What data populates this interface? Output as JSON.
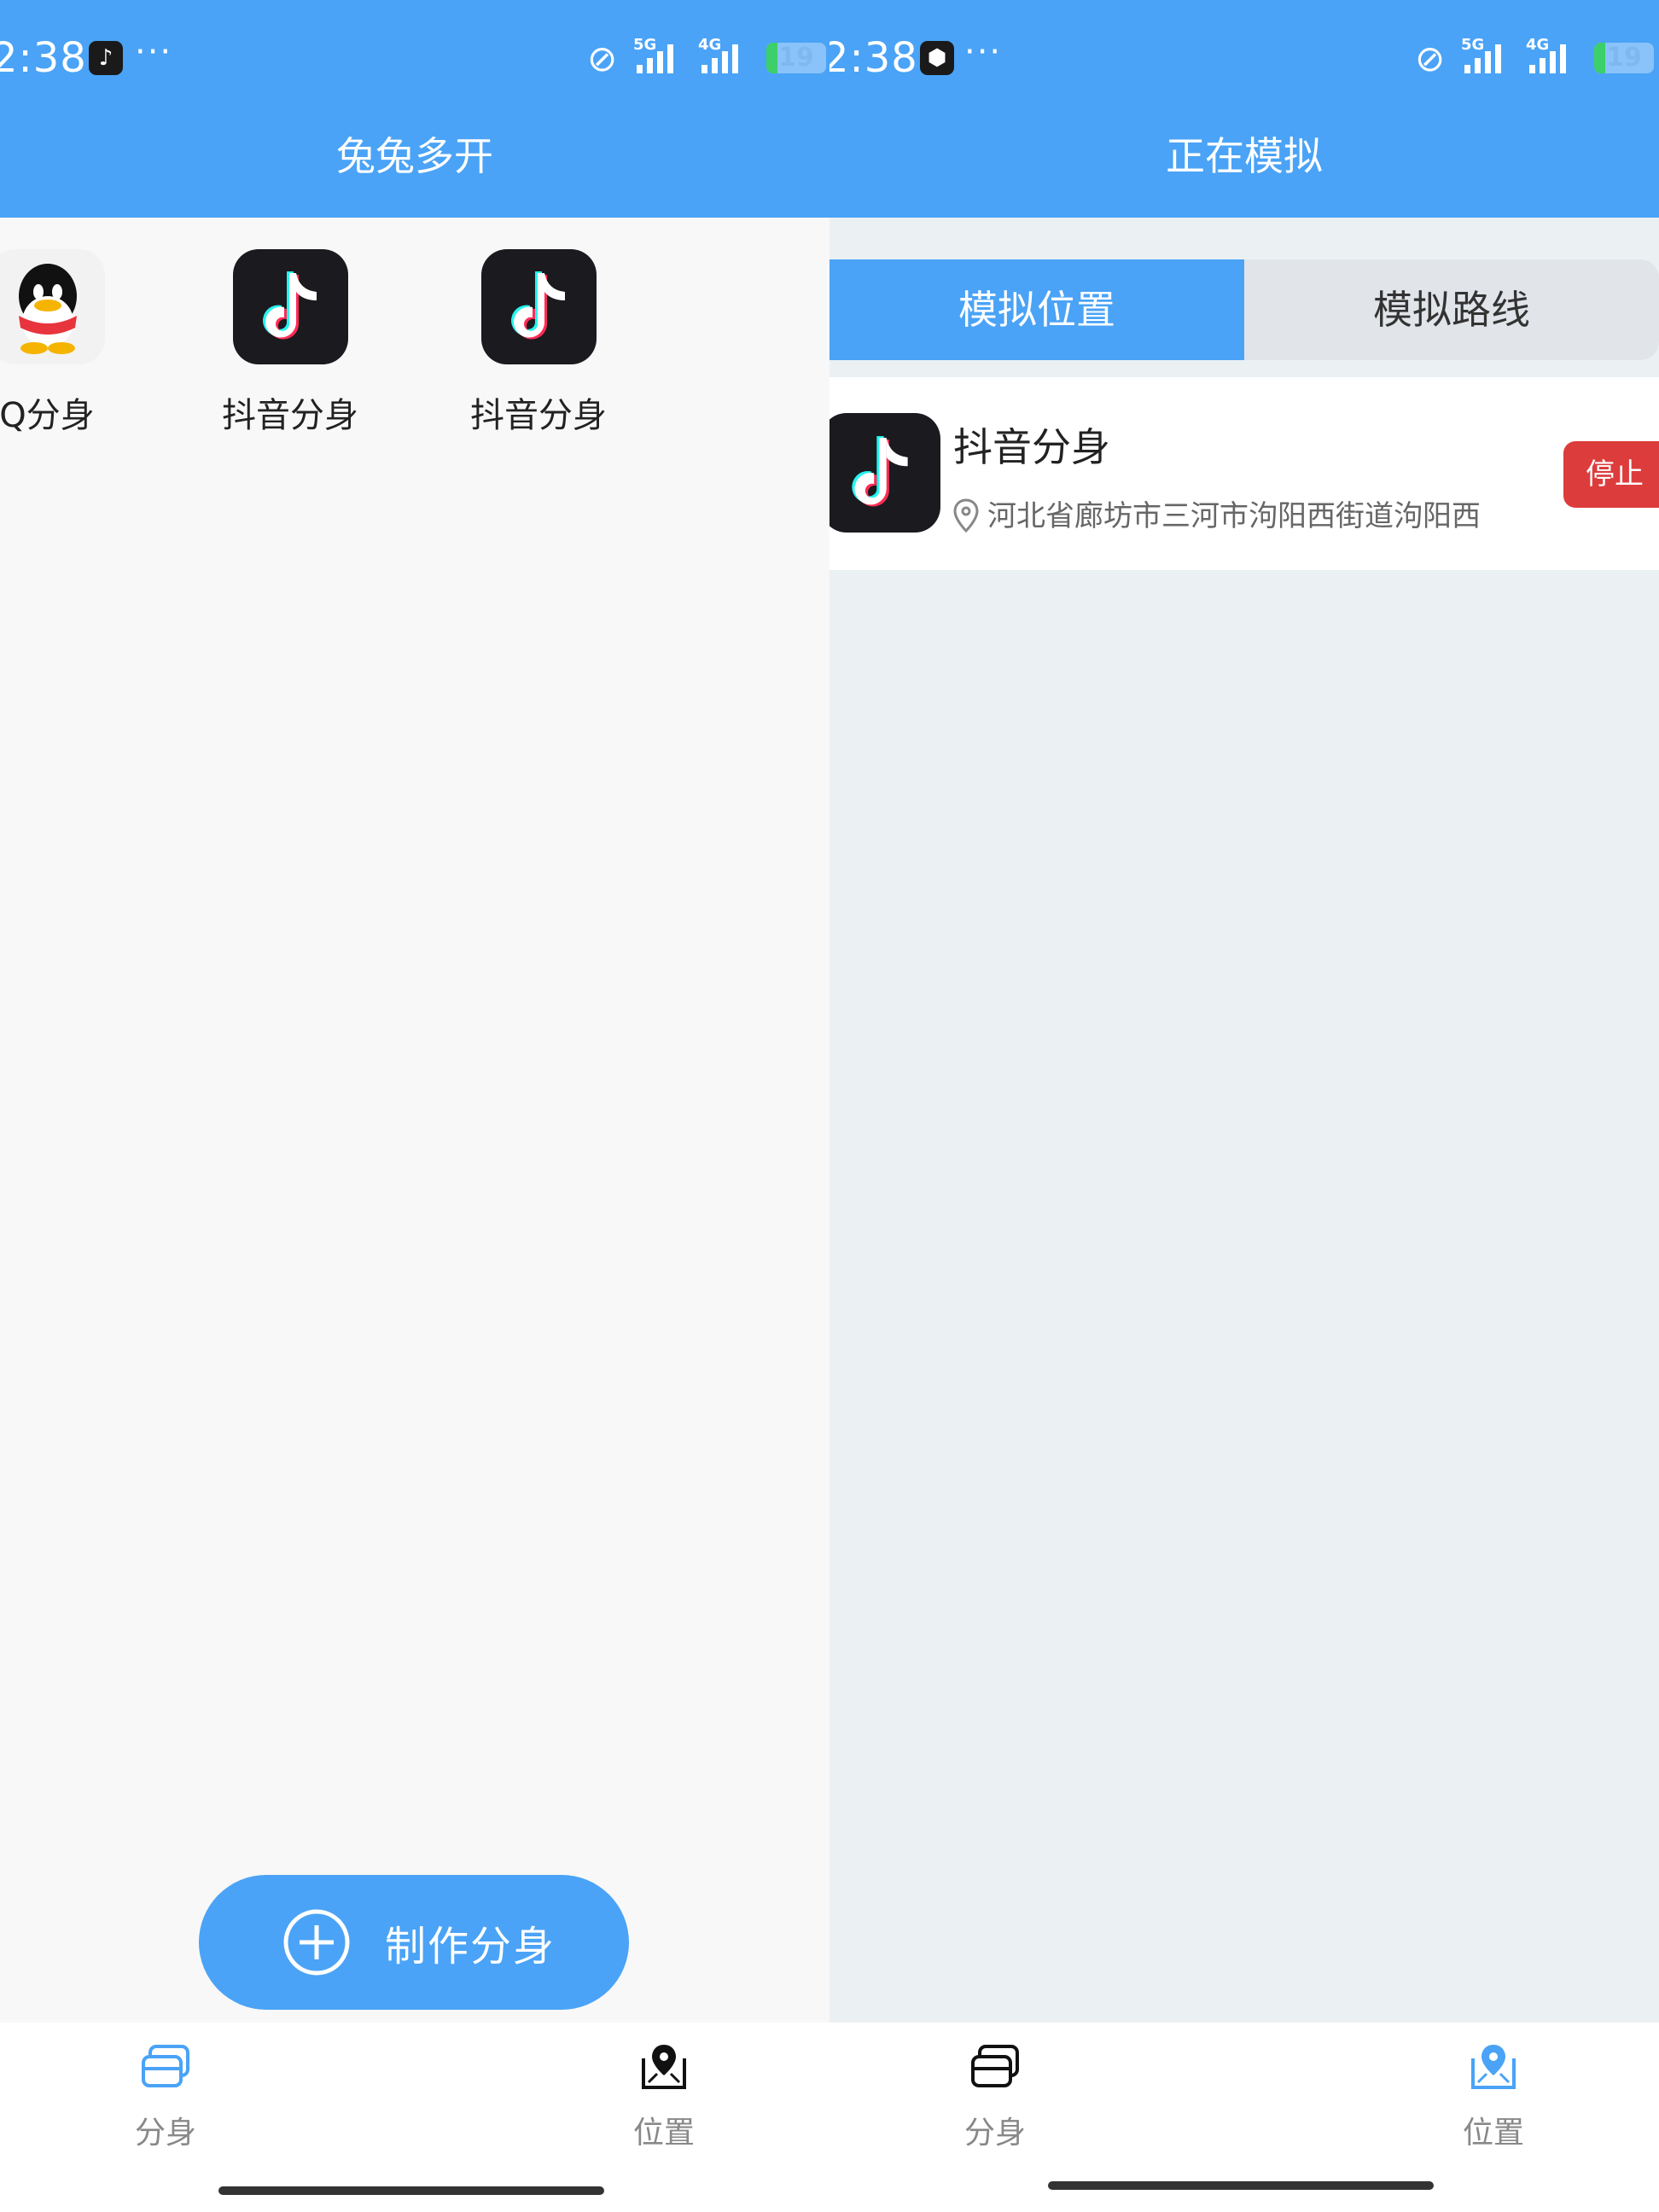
{
  "left": {
    "status": {
      "time": ":38",
      "time_prefix": "2",
      "dots": "···",
      "battery": "19"
    },
    "title": "兔兔多开",
    "apps": [
      {
        "label": "Q分身",
        "icon": "qq-penguin-icon"
      },
      {
        "label": "抖音分身",
        "icon": "tiktok-icon"
      },
      {
        "label": "抖音分身",
        "icon": "tiktok-icon"
      }
    ],
    "fab_label": "制作分身",
    "nav": {
      "clone": "分身",
      "location": "位置"
    }
  },
  "right": {
    "status": {
      "time": ":38",
      "time_prefix": "2",
      "dots": "···",
      "battery": "19"
    },
    "title": "正在模拟",
    "tabs": {
      "position": "模拟位置",
      "route": "模拟路线"
    },
    "sim": {
      "name": "抖音分身",
      "address": "河北省廊坊市三河市泃阳西街道泃阳西",
      "stop": "停止"
    },
    "nav": {
      "clone": "分身",
      "location": "位置"
    }
  },
  "colors": {
    "primary": "#4aa3f6",
    "danger": "#dd3c3c",
    "battery": "#3ccf6a"
  }
}
